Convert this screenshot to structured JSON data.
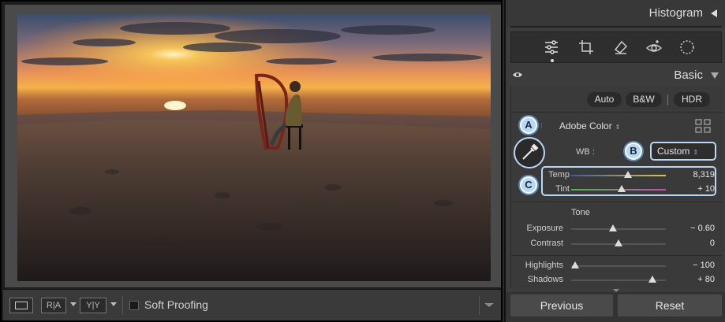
{
  "toolbar": {
    "view_icon": "loupe-view-icon",
    "before_after_ra": "R|A",
    "before_after_yy": "Y|Y",
    "soft_proofing_label": "Soft Proofing"
  },
  "histogram": {
    "title": "Histogram"
  },
  "tools": [
    "sliders-icon",
    "crop-icon",
    "eraser-icon",
    "red-eye-icon",
    "mask-icon"
  ],
  "basic": {
    "title": "Basic",
    "auto_label": "Auto",
    "bw_label": "B&W",
    "hdr_label": "HDR",
    "profile_label": "Adobe Color",
    "wb_label": "WB :",
    "wb_value": "Custom",
    "callouts": [
      "A",
      "B",
      "C"
    ],
    "temp": {
      "label": "Temp",
      "value": "8,319",
      "position": 0.6
    },
    "tint": {
      "label": "Tint",
      "value": "+ 10",
      "position": 0.53
    },
    "tone_label": "Tone",
    "exposure": {
      "label": "Exposure",
      "value": "− 0.60",
      "position": 0.44
    },
    "contrast": {
      "label": "Contrast",
      "value": "0",
      "position": 0.5
    },
    "highlights": {
      "label": "Highlights",
      "value": "− 100",
      "position": 0.0
    },
    "shadows": {
      "label": "Shadows",
      "value": "+ 80",
      "position": 0.88
    }
  },
  "footer": {
    "previous_label": "Previous",
    "reset_label": "Reset"
  },
  "colors": {
    "callout_fill": "#b9d8f5",
    "panel_bg": "#3c3c3c"
  }
}
